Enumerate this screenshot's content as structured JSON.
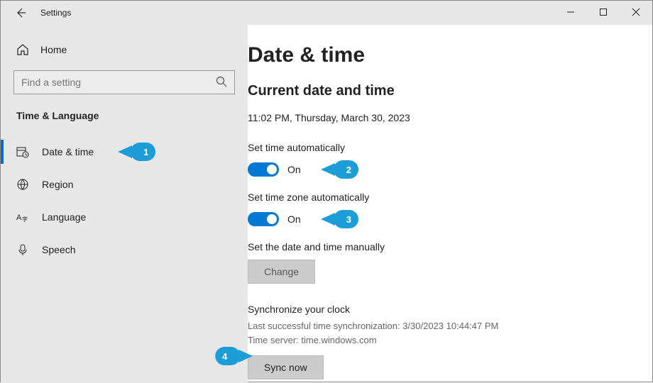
{
  "titlebar": {
    "title": "Settings"
  },
  "sidebar": {
    "home": "Home",
    "search_placeholder": "Find a setting",
    "category": "Time & Language",
    "items": [
      {
        "label": "Date & time"
      },
      {
        "label": "Region"
      },
      {
        "label": "Language"
      },
      {
        "label": "Speech"
      }
    ]
  },
  "main": {
    "title": "Date & time",
    "section_title": "Current date and time",
    "current": "11:02 PM, Thursday, March 30, 2023",
    "set_time_auto_label": "Set time automatically",
    "set_time_auto_state": "On",
    "set_tz_auto_label": "Set time zone automatically",
    "set_tz_auto_state": "On",
    "manual_label": "Set the date and time manually",
    "change_btn": "Change",
    "sync_heading": "Synchronize your clock",
    "sync_last": "Last successful time synchronization: 3/30/2023 10:44:47 PM",
    "sync_server": "Time server: time.windows.com",
    "sync_btn": "Sync now"
  },
  "callouts": {
    "c1": "1",
    "c2": "2",
    "c3": "3",
    "c4": "4"
  }
}
